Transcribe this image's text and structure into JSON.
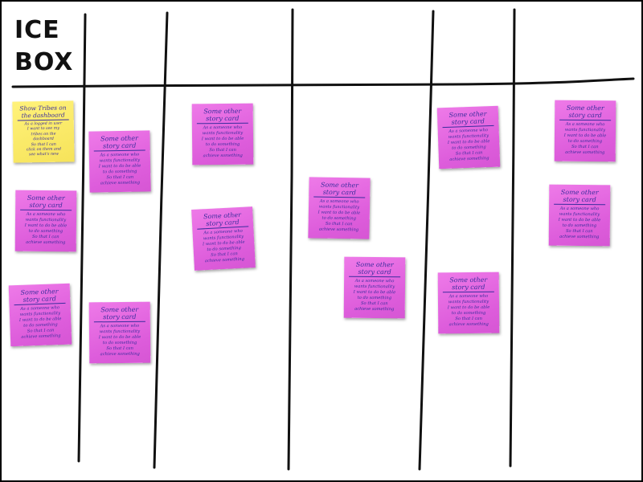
{
  "board": {
    "icebox_title_line1": "ICE",
    "icebox_title_line2": "BOX",
    "colors": {
      "board": "#ffffff",
      "frame": "#000000",
      "pink_note": "#e066de",
      "yellow_note": "#f8e65f",
      "note_ink": "#3b2e9e"
    }
  },
  "cards": [
    {
      "color": "yellow",
      "title": "Show Tribes on\nthe dashboard",
      "body": "As a logged in user\nI want to see my\ntribes on the\ndashboard\nSo that I can\nclick on them and\nsee what's new"
    },
    {
      "color": "pink",
      "title": "Some other\nstory card",
      "body": "As a someone who\nwants functionality\nI want to do be able\nto do something\nSo that I can\nachieve something"
    },
    {
      "color": "pink",
      "title": "Some other\nstory card",
      "body": "As a someone who\nwants functionality\nI want to do be able\nto do something\nSo that I can\nachieve something"
    },
    {
      "color": "pink",
      "title": "Some other\nstory card",
      "body": "As a someone who\nwants functionality\nI want to do be able\nto do something\nSo that I can\nachieve something"
    },
    {
      "color": "pink",
      "title": "Some other\nstory card",
      "body": "As a someone who\nwants functionality\nI want to do be able\nto do something\nSo that I can\nachieve something"
    },
    {
      "color": "pink",
      "title": "Some other\nstory card",
      "body": "As a someone who\nwants functionality\nI want to do be able\nto do something\nSo that I can\nachieve something"
    },
    {
      "color": "pink",
      "title": "Some other\nstory card",
      "body": "As a someone who\nwants functionality\nI want to do be able\nto do something\nSo that I can\nachieve something"
    },
    {
      "color": "pink",
      "title": "Some other\nstory card",
      "body": "As a someone who\nwants functionality\nI want to do be able\nto do something\nSo that I can\nachieve something"
    },
    {
      "color": "pink",
      "title": "Some other\nstory card",
      "body": "As a someone who\nwants functionality\nI want to do be able\nto do something\nSo that I can\nachieve something"
    },
    {
      "color": "pink",
      "title": "Some other\nstory card",
      "body": "As a someone who\nwants functionality\nI want to do be able\nto do something\nSo that I can\nachieve something"
    },
    {
      "color": "pink",
      "title": "Some other\nstory card",
      "body": "As a someone who\nwants functionality\nI want to do be able\nto do something\nSo that I can\nachieve something"
    },
    {
      "color": "pink",
      "title": "Some other\nstory card",
      "body": "As a someone who\nwants functionality\nI want to do be able\nto do something\nSo that I can\nachieve something"
    },
    {
      "color": "pink",
      "title": "Some other\nstory card",
      "body": "As a someone who\nwants functionality\nI want to do be able\nto do something\nSo that I can\nachieve something"
    },
    {
      "color": "pink",
      "title": "Some other\nstory card",
      "body": "As a someone who\nwants functionality\nI want to do be able\nto do something\nSo that I can\nachieve something"
    }
  ]
}
